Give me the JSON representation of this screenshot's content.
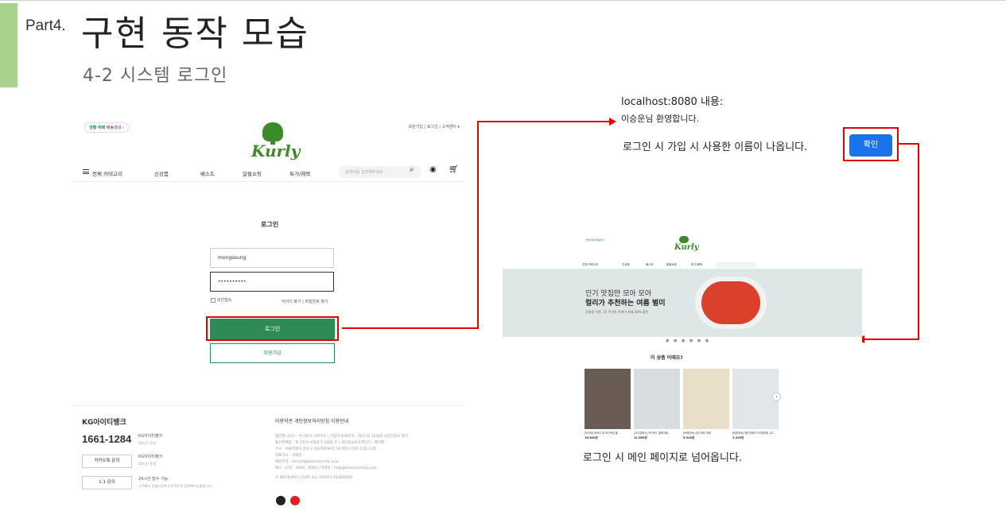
{
  "slide": {
    "part_label": "Part4.",
    "title": "구현 동작 모습",
    "subtitle": "4-2 시스템 로그인"
  },
  "login_page": {
    "badge_bold": "샛별·택배",
    "badge_rest": "배송안내 ›",
    "top_links": "회원가입 | 로그인 | 고객센터 ▾",
    "logo_text": "Kurly",
    "nav": {
      "menu": "전체 카테고리",
      "new": "신상품",
      "best": "베스트",
      "sale": "알뜰쇼핑",
      "special": "특가/혜택",
      "search_placeholder": "검색어를 입력해주세요"
    },
    "title": "로그인",
    "id_value": "mongseung",
    "pw_value": "••••••••••",
    "keep_login": "보안접속",
    "find_links": "아이디 찾기 | 비밀번호 찾기",
    "login_button": "로그인",
    "signup_button": "회원가입",
    "footer": {
      "brand": "KG아이티뱅크",
      "phone": "1661-1284",
      "side1": "KG아이티뱅크",
      "side1_sub": "24시간 운영",
      "side2": "KG아이티뱅크",
      "side2_sub": "24시간 운영",
      "side3": "24시간 접수 가능",
      "side3_sub": "고객센터 운영시간에 순차적으로 답변해드리겠습니다.",
      "btn_kakao": "카카오톡 문의",
      "btn_one": "1:1 문의",
      "links": "이용약관    개인정보처리방침    이용안내",
      "info": [
        "법인명 (상호) : 주식회사 브로코리 | 사업자 등록번호 : 123 12 12345 사업자정보 확인",
        "통신판매업 : 제 2019 서울중구 2086 호 | 개인정보보호책임자 : 배지혜",
        "주소 : 서울특별시 강남구 강남대로94길 16 제이스타워 11층-12층",
        "대표이사 : 서해린",
        "채용문의 : recruit@brokurlycorp.com",
        "팩스 : 070 · 0000 · 0000 | 이메일 : help@brokurlycorp.com",
        "© BROKURLY CORP. ALL RIGHTS RESERVED"
      ]
    }
  },
  "alert": {
    "host_line": "localhost:8080 내용:",
    "message": "이승운님 환영합니다.",
    "note": "로그인 시 가입 시 사용한 이름이 나옵니다.",
    "ok_button": "확인"
  },
  "main_page": {
    "badge": "샛별·택배 배송안내",
    "logo_text": "Kurly",
    "nav": {
      "menu": "전체 카테고리",
      "new": "신상품",
      "best": "베스트",
      "sale": "알뜰쇼핑",
      "special": "특가/혜택"
    },
    "banner_line1": "인기 맛집만 모아 모아",
    "banner_line2": "컬리가 추천하는 여름 별미",
    "banner_line3": "공회용 이천, 15 주년의 마케이 최대 30% 할인",
    "dots": "● ● ● ● ● ●",
    "recommend_title": "이 상품 어때요?",
    "products": [
      {
        "desc": "[모가네] 토마오 로가리 목심 불...",
        "price": "16,800원"
      },
      {
        "desc": "[코스알엑스] 어드밴스 클레이레...",
        "price": "12,600원"
      },
      {
        "desc": "[브레이브] 로건 버터 모찜",
        "price": "5,900원"
      },
      {
        "desc": "[비원아트] 메이지메이 드리온한트 18...",
        "price": "3,200원"
      }
    ],
    "caption": "로그인 시 메인 페이지로 넘어옵니다."
  },
  "colors": {
    "kurly_green": "#2e8b57",
    "highlight_red": "#e00000",
    "alert_blue": "#1a73e8",
    "slide_bar": "#a9d18e"
  }
}
